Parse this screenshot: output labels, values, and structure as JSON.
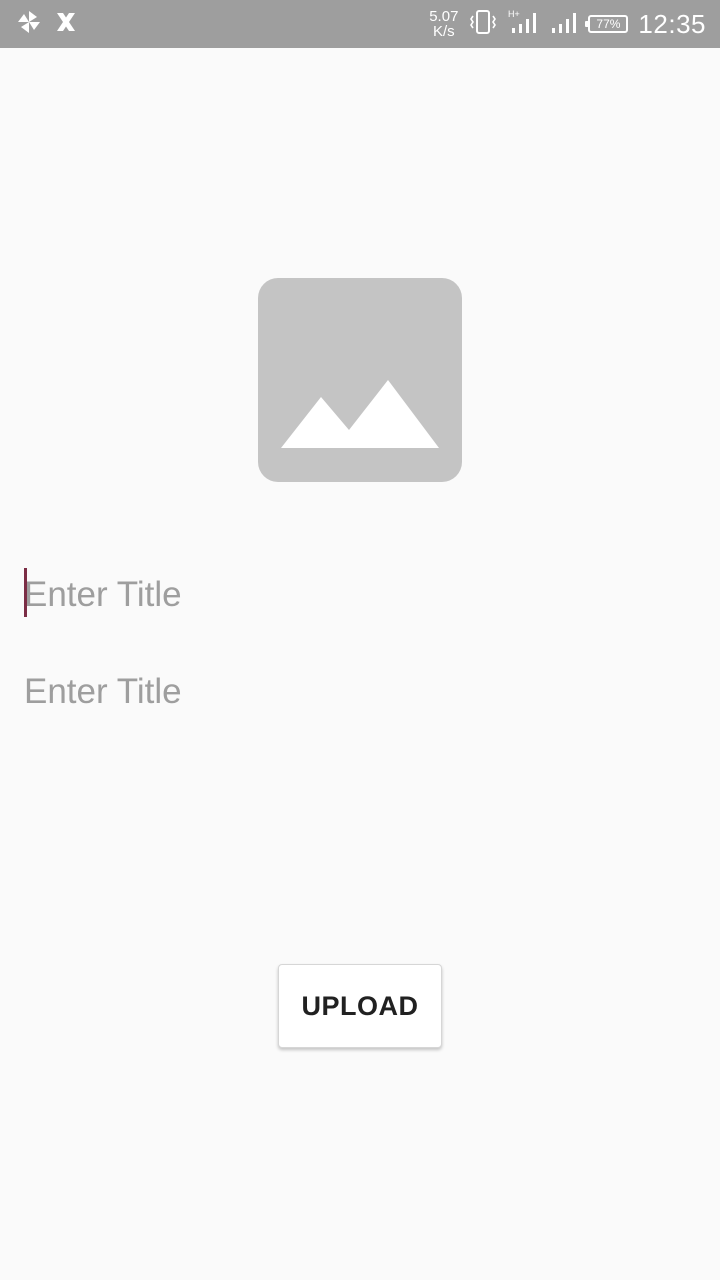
{
  "status_bar": {
    "left_icons": [
      "pinwheel-icon",
      "x-icon"
    ],
    "net_speed_value": "5.07",
    "net_speed_unit": "K/s",
    "right_icons": [
      "vibrate-icon",
      "signal-hplus-icon",
      "signal-icon"
    ],
    "battery_percent": "77%",
    "time": "12:35",
    "background_color": "#9e9e9e"
  },
  "main": {
    "image_placeholder_icon": "image-icon",
    "title_input_1": {
      "placeholder": "Enter Title",
      "value": ""
    },
    "title_input_2": {
      "placeholder": "Enter Title",
      "value": ""
    },
    "upload_button_label": "UPLOAD"
  },
  "colors": {
    "background": "#fafafa",
    "placeholder_box": "#c4c4c4",
    "hint_text": "#9e9e9e",
    "cursor": "#7b2d45"
  }
}
